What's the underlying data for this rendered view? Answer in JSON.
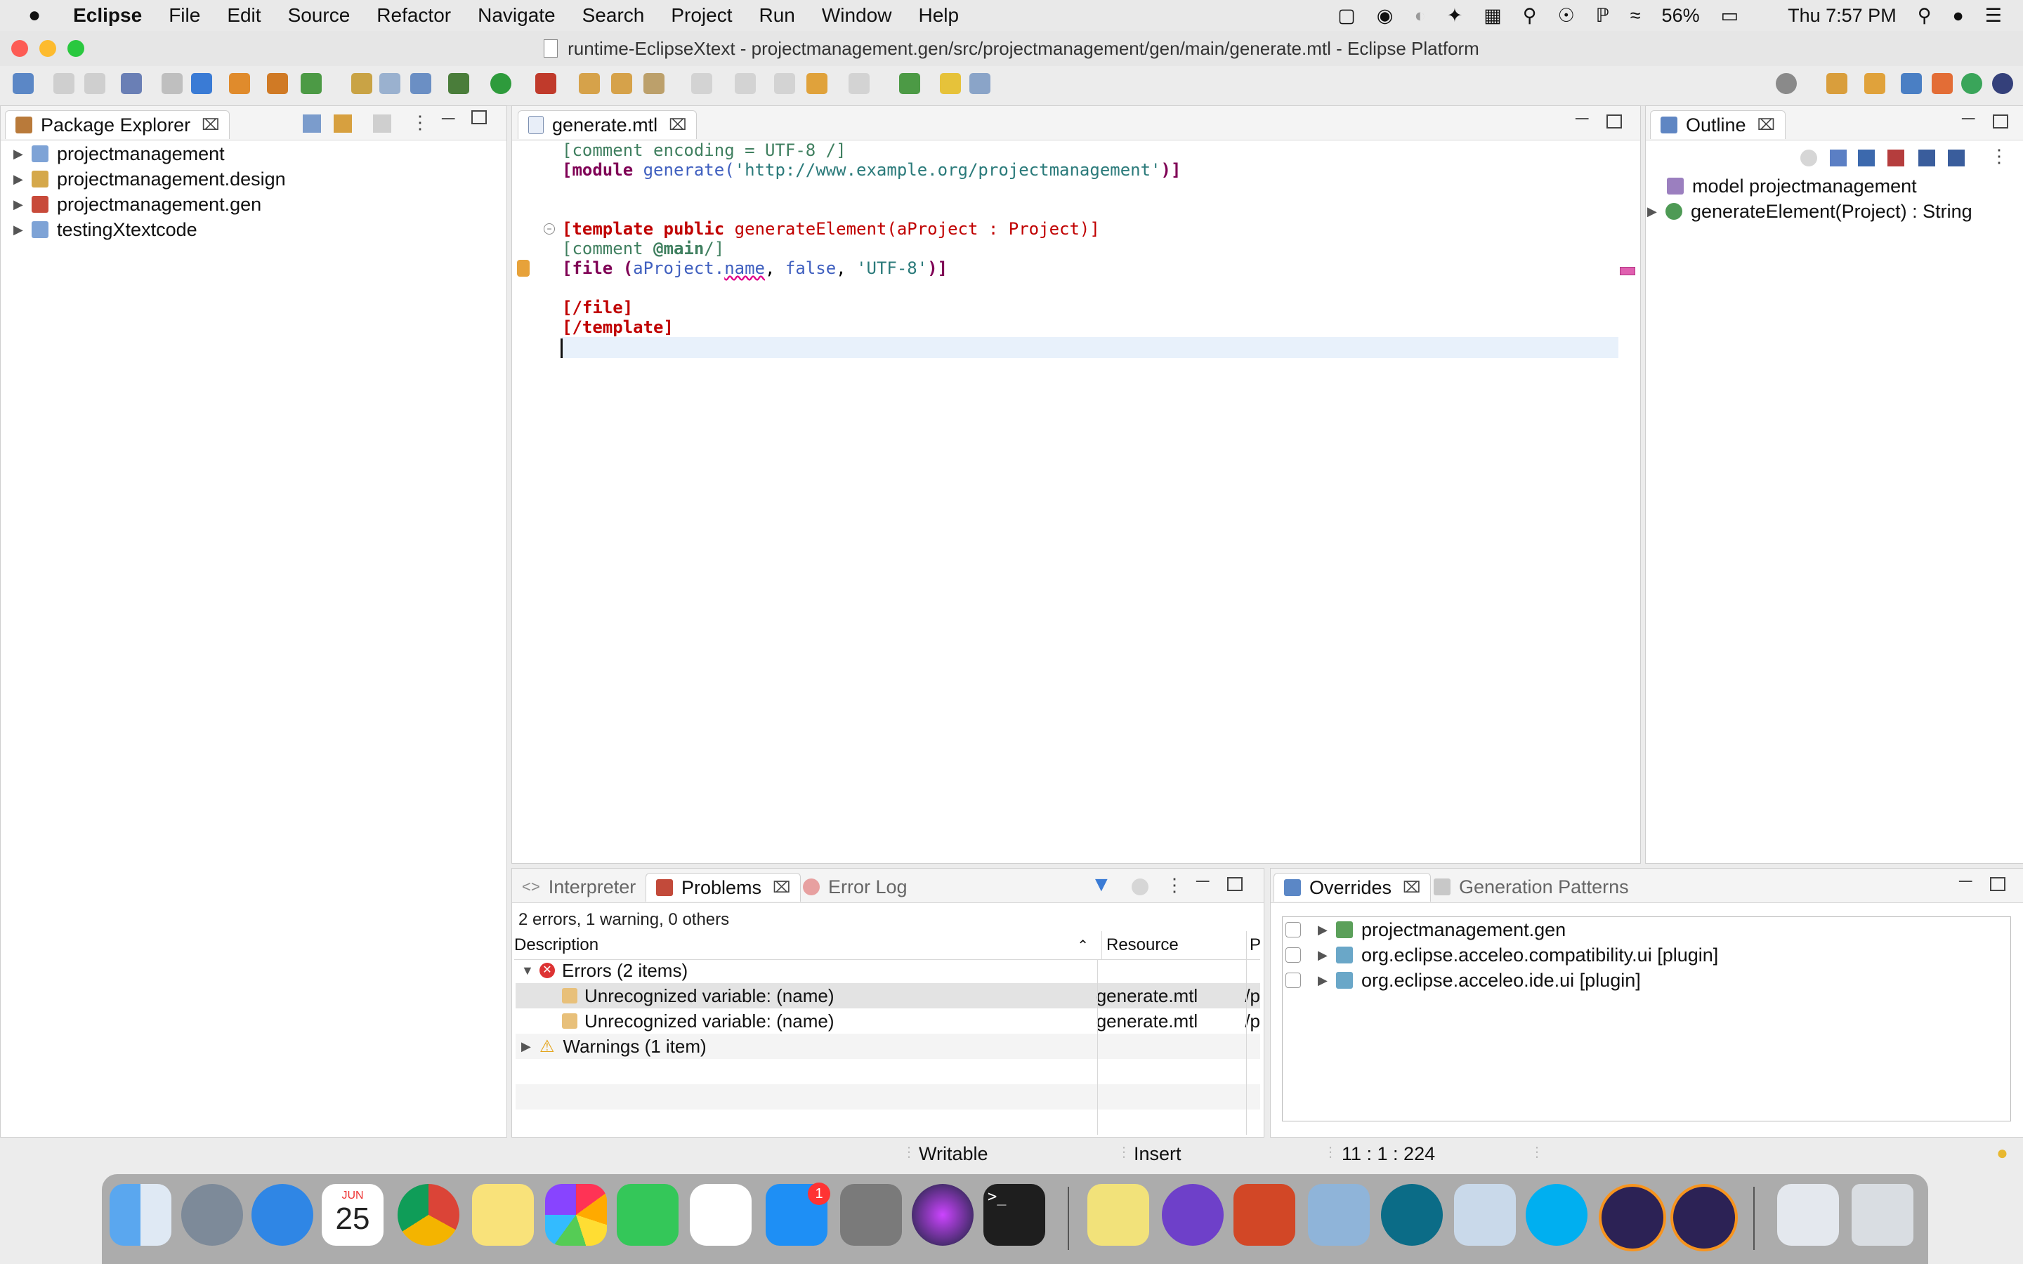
{
  "menubar": {
    "app_name": "Eclipse",
    "items": [
      "File",
      "Edit",
      "Source",
      "Refactor",
      "Navigate",
      "Search",
      "Project",
      "Run",
      "Window",
      "Help"
    ],
    "battery": "56%",
    "clock": "Thu 7:57 PM"
  },
  "window": {
    "title": "runtime-EclipseXtext - projectmanagement.gen/src/projectmanagement/gen/main/generate.mtl - Eclipse Platform"
  },
  "package_explorer": {
    "title": "Package Explorer",
    "projects": [
      "projectmanagement",
      "projectmanagement.design",
      "projectmanagement.gen",
      "testingXtextcode"
    ]
  },
  "editor": {
    "tab_label": "generate.mtl",
    "lines": {
      "l1": "[comment encoding = UTF-8 /]",
      "l2_open": "[module ",
      "l2_name": "generate(",
      "l2_uri": "'http://www.example.org/projectmanagement'",
      "l2_close": ")]",
      "l5_open": "[template public ",
      "l5_rest": "generateElement(aProject : Project)]",
      "l6_open": "[comment ",
      "l6_main": "@main",
      "l6_close": "/]",
      "l7_open": "[file (",
      "l7_var": "aProject.",
      "l7_name": "name",
      "l7_sep": ", ",
      "l7_false": "false",
      "l7_sep2": ", ",
      "l7_str": "'UTF-8'",
      "l7_close": ")]",
      "l9": "[/file]",
      "l10": "[/template]"
    }
  },
  "outline": {
    "title": "Outline",
    "items": [
      "model projectmanagement",
      "generateElement(Project) : String"
    ]
  },
  "problems": {
    "tabs": [
      "Interpreter",
      "Problems",
      "Error Log"
    ],
    "summary": "2 errors, 1 warning, 0 others",
    "columns": [
      "Description",
      "Resource",
      "P"
    ],
    "errors_group": "Errors (2 items)",
    "rows": [
      {
        "description": "Unrecognized variable: (name)",
        "resource": "generate.mtl",
        "path": "/p"
      },
      {
        "description": "Unrecognized variable: (name)",
        "resource": "generate.mtl",
        "path": "/p"
      }
    ],
    "warnings_group": "Warnings (1 item)"
  },
  "overrides": {
    "tabs": [
      "Overrides",
      "Generation Patterns"
    ],
    "items": [
      "projectmanagement.gen",
      "org.eclipse.acceleo.compatibility.ui [plugin]",
      "org.eclipse.acceleo.ide.ui [plugin]"
    ]
  },
  "statusbar": {
    "writable": "Writable",
    "insert": "Insert",
    "position": "11 : 1 : 224"
  },
  "dock": {
    "calendar_month": "JUN",
    "calendar_day": "25",
    "appstore_badge": "1"
  },
  "colors": {
    "keyword": "#7f0055",
    "comment": "#3f7f5f",
    "error": "#c00000",
    "string": "#2a00ff"
  }
}
